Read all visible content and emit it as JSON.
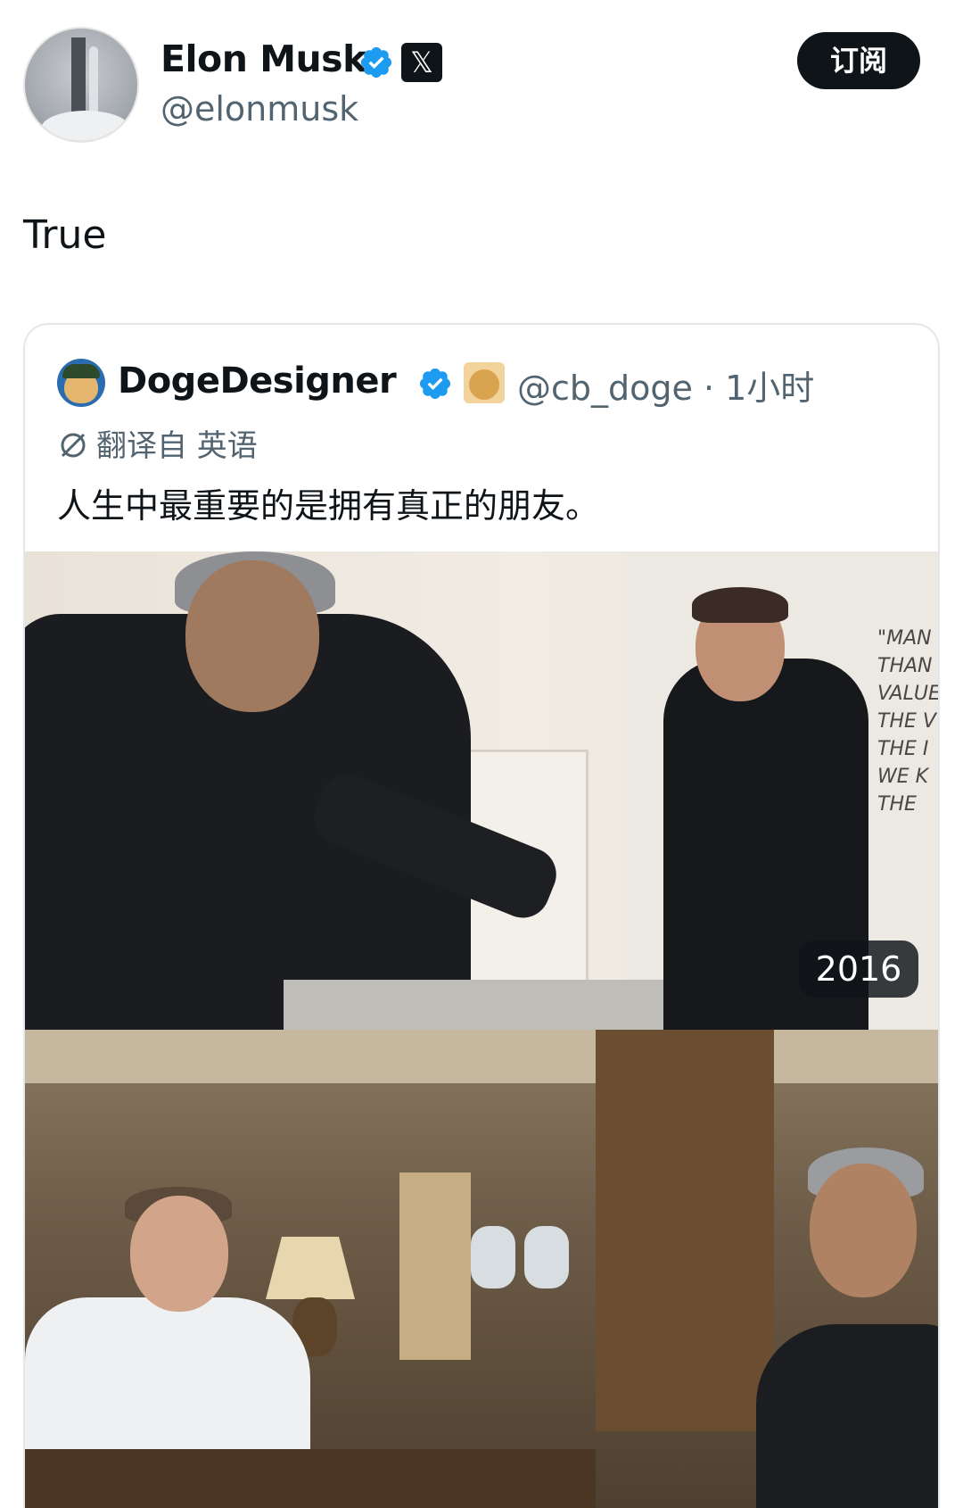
{
  "author": {
    "name": "Elon Musk",
    "handle": "@elonmusk",
    "verified_icon": "verified-badge-icon",
    "affiliation_badge": "𝕏"
  },
  "actions": {
    "subscribe_label": "订阅"
  },
  "tweet": {
    "text": "True"
  },
  "quoted_tweet": {
    "author_name": "DogeDesigner",
    "handle_time": "@cb_doge · 1小时",
    "translation_note": "翻译自 英语",
    "text": "人生中最重要的是拥有真正的朋友。",
    "media": {
      "photo1_year_badge": "2016",
      "photo1_wall_text": "\"MAN H\nTHAN\nVALUE\nTHE V\nTHE I\nWE K\nTHE"
    }
  },
  "colors": {
    "text_primary": "#0f1419",
    "text_secondary": "#536471",
    "verified_blue": "#1d9bf0",
    "button_bg": "#0f1419"
  }
}
